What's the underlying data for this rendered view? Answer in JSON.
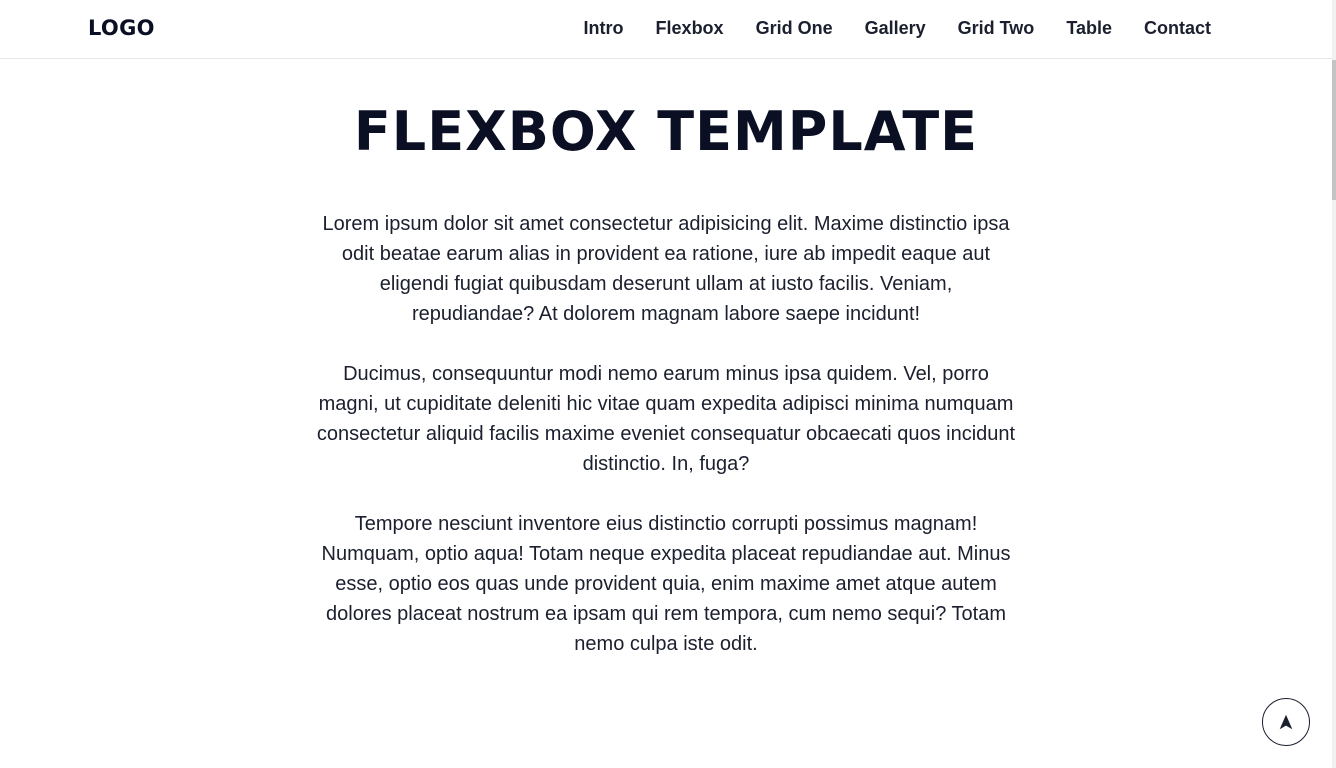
{
  "header": {
    "logo": "LOGO",
    "nav": [
      {
        "label": "Intro"
      },
      {
        "label": "Flexbox"
      },
      {
        "label": "Grid One"
      },
      {
        "label": "Gallery"
      },
      {
        "label": "Grid Two"
      },
      {
        "label": "Table"
      },
      {
        "label": "Contact"
      }
    ]
  },
  "main": {
    "title": "FLEXBOX TEMPLATE",
    "paragraphs": [
      "Lorem ipsum dolor sit amet consectetur adipisicing elit. Maxime distinctio ipsa odit beatae earum alias in provident ea ratione, iure ab impedit eaque aut eligendi fugiat quibusdam deserunt ullam at iusto facilis. Veniam, repudiandae? At dolorem magnam labore saepe incidunt!",
      "Ducimus, consequuntur modi nemo earum minus ipsa quidem. Vel, porro magni, ut cupiditate deleniti hic vitae quam expedita adipisci minima numquam consectetur aliquid facilis maxime eveniet consequatur obcaecati quos incidunt distinctio. In, fuga?",
      "Tempore nesciunt inventore eius distinctio corrupti possimus magnam! Numquam, optio aqua! Totam neque expedita placeat repudiandae aut. Minus esse, optio eos quas unde provident quia, enim maxime amet atque autem dolores placeat nostrum ea ipsam qui rem tempora, cum nemo sequi? Totam nemo culpa iste odit."
    ]
  },
  "scroll_top_button": {
    "icon": "arrow-up-icon"
  },
  "colors": {
    "text": "#1b1f2e",
    "heading": "#0b0f24",
    "background": "#ffffff",
    "border": "#e6e6e6"
  }
}
